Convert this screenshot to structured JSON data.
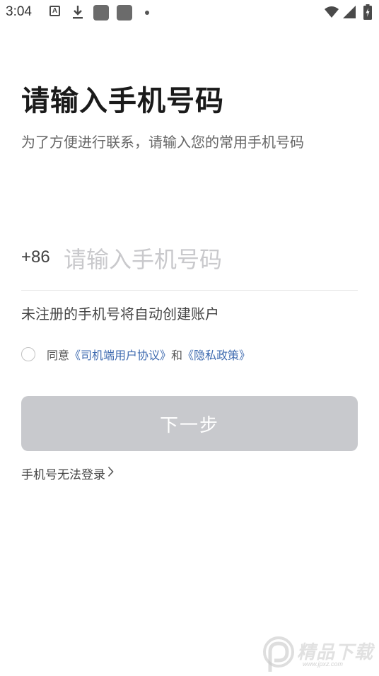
{
  "status_bar": {
    "time": "3:04",
    "a_icon_letter": "A",
    "icons": [
      "a-notification-icon",
      "download-icon",
      "app-square-icon",
      "app-square-icon",
      "more-dot-icon",
      "wifi-icon",
      "signal-icon",
      "battery-charging-icon"
    ]
  },
  "main": {
    "title": "请输入手机号码",
    "subtitle": "为了方便进行联系，请输入您的常用手机号码",
    "country_code": "+86",
    "phone_placeholder": "请输入手机号码",
    "phone_value": "",
    "register_hint": "未注册的手机号将自动创建账户",
    "agreement": {
      "checked": false,
      "prefix": "同意",
      "user_agreement": "《司机端用户协议》",
      "conjunction": "和",
      "privacy_policy": "《隐私政策》"
    },
    "next_button": "下一步",
    "cannot_login": "手机号无法登录"
  },
  "watermark": {
    "text": "精品下载",
    "url": "www.jpxz.com"
  },
  "colors": {
    "link": "#3f6bb0",
    "button_disabled": "#c8c9cd",
    "placeholder": "#c9c9cc"
  }
}
